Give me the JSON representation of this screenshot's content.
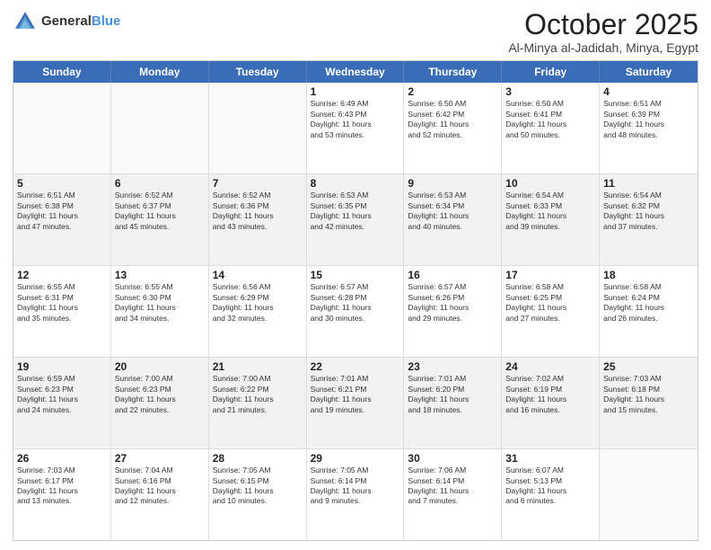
{
  "header": {
    "logo_general": "General",
    "logo_blue": "Blue",
    "title": "October 2025",
    "subtitle": "Al-Minya al-Jadidah, Minya, Egypt"
  },
  "days_of_week": [
    "Sunday",
    "Monday",
    "Tuesday",
    "Wednesday",
    "Thursday",
    "Friday",
    "Saturday"
  ],
  "rows": [
    [
      {
        "day": "",
        "text": "",
        "shaded": false,
        "empty": true
      },
      {
        "day": "",
        "text": "",
        "shaded": false,
        "empty": true
      },
      {
        "day": "",
        "text": "",
        "shaded": false,
        "empty": true
      },
      {
        "day": "1",
        "text": "Sunrise: 6:49 AM\nSunset: 6:43 PM\nDaylight: 11 hours\nand 53 minutes.",
        "shaded": false
      },
      {
        "day": "2",
        "text": "Sunrise: 6:50 AM\nSunset: 6:42 PM\nDaylight: 11 hours\nand 52 minutes.",
        "shaded": false
      },
      {
        "day": "3",
        "text": "Sunrise: 6:50 AM\nSunset: 6:41 PM\nDaylight: 11 hours\nand 50 minutes.",
        "shaded": false
      },
      {
        "day": "4",
        "text": "Sunrise: 6:51 AM\nSunset: 6:39 PM\nDaylight: 11 hours\nand 48 minutes.",
        "shaded": false
      }
    ],
    [
      {
        "day": "5",
        "text": "Sunrise: 6:51 AM\nSunset: 6:38 PM\nDaylight: 11 hours\nand 47 minutes.",
        "shaded": true
      },
      {
        "day": "6",
        "text": "Sunrise: 6:52 AM\nSunset: 6:37 PM\nDaylight: 11 hours\nand 45 minutes.",
        "shaded": true
      },
      {
        "day": "7",
        "text": "Sunrise: 6:52 AM\nSunset: 6:36 PM\nDaylight: 11 hours\nand 43 minutes.",
        "shaded": true
      },
      {
        "day": "8",
        "text": "Sunrise: 6:53 AM\nSunset: 6:35 PM\nDaylight: 11 hours\nand 42 minutes.",
        "shaded": true
      },
      {
        "day": "9",
        "text": "Sunrise: 6:53 AM\nSunset: 6:34 PM\nDaylight: 11 hours\nand 40 minutes.",
        "shaded": true
      },
      {
        "day": "10",
        "text": "Sunrise: 6:54 AM\nSunset: 6:33 PM\nDaylight: 11 hours\nand 39 minutes.",
        "shaded": true
      },
      {
        "day": "11",
        "text": "Sunrise: 6:54 AM\nSunset: 6:32 PM\nDaylight: 11 hours\nand 37 minutes.",
        "shaded": true
      }
    ],
    [
      {
        "day": "12",
        "text": "Sunrise: 6:55 AM\nSunset: 6:31 PM\nDaylight: 11 hours\nand 35 minutes.",
        "shaded": false
      },
      {
        "day": "13",
        "text": "Sunrise: 6:55 AM\nSunset: 6:30 PM\nDaylight: 11 hours\nand 34 minutes.",
        "shaded": false
      },
      {
        "day": "14",
        "text": "Sunrise: 6:56 AM\nSunset: 6:29 PM\nDaylight: 11 hours\nand 32 minutes.",
        "shaded": false
      },
      {
        "day": "15",
        "text": "Sunrise: 6:57 AM\nSunset: 6:28 PM\nDaylight: 11 hours\nand 30 minutes.",
        "shaded": false
      },
      {
        "day": "16",
        "text": "Sunrise: 6:57 AM\nSunset: 6:26 PM\nDaylight: 11 hours\nand 29 minutes.",
        "shaded": false
      },
      {
        "day": "17",
        "text": "Sunrise: 6:58 AM\nSunset: 6:25 PM\nDaylight: 11 hours\nand 27 minutes.",
        "shaded": false
      },
      {
        "day": "18",
        "text": "Sunrise: 6:58 AM\nSunset: 6:24 PM\nDaylight: 11 hours\nand 26 minutes.",
        "shaded": false
      }
    ],
    [
      {
        "day": "19",
        "text": "Sunrise: 6:59 AM\nSunset: 6:23 PM\nDaylight: 11 hours\nand 24 minutes.",
        "shaded": true
      },
      {
        "day": "20",
        "text": "Sunrise: 7:00 AM\nSunset: 6:23 PM\nDaylight: 11 hours\nand 22 minutes.",
        "shaded": true
      },
      {
        "day": "21",
        "text": "Sunrise: 7:00 AM\nSunset: 6:22 PM\nDaylight: 11 hours\nand 21 minutes.",
        "shaded": true
      },
      {
        "day": "22",
        "text": "Sunrise: 7:01 AM\nSunset: 6:21 PM\nDaylight: 11 hours\nand 19 minutes.",
        "shaded": true
      },
      {
        "day": "23",
        "text": "Sunrise: 7:01 AM\nSunset: 6:20 PM\nDaylight: 11 hours\nand 18 minutes.",
        "shaded": true
      },
      {
        "day": "24",
        "text": "Sunrise: 7:02 AM\nSunset: 6:19 PM\nDaylight: 11 hours\nand 16 minutes.",
        "shaded": true
      },
      {
        "day": "25",
        "text": "Sunrise: 7:03 AM\nSunset: 6:18 PM\nDaylight: 11 hours\nand 15 minutes.",
        "shaded": true
      }
    ],
    [
      {
        "day": "26",
        "text": "Sunrise: 7:03 AM\nSunset: 6:17 PM\nDaylight: 11 hours\nand 13 minutes.",
        "shaded": false
      },
      {
        "day": "27",
        "text": "Sunrise: 7:04 AM\nSunset: 6:16 PM\nDaylight: 11 hours\nand 12 minutes.",
        "shaded": false
      },
      {
        "day": "28",
        "text": "Sunrise: 7:05 AM\nSunset: 6:15 PM\nDaylight: 11 hours\nand 10 minutes.",
        "shaded": false
      },
      {
        "day": "29",
        "text": "Sunrise: 7:05 AM\nSunset: 6:14 PM\nDaylight: 11 hours\nand 9 minutes.",
        "shaded": false
      },
      {
        "day": "30",
        "text": "Sunrise: 7:06 AM\nSunset: 6:14 PM\nDaylight: 11 hours\nand 7 minutes.",
        "shaded": false
      },
      {
        "day": "31",
        "text": "Sunrise: 6:07 AM\nSunset: 5:13 PM\nDaylight: 11 hours\nand 6 minutes.",
        "shaded": false
      },
      {
        "day": "",
        "text": "",
        "shaded": false,
        "empty": true
      }
    ]
  ]
}
